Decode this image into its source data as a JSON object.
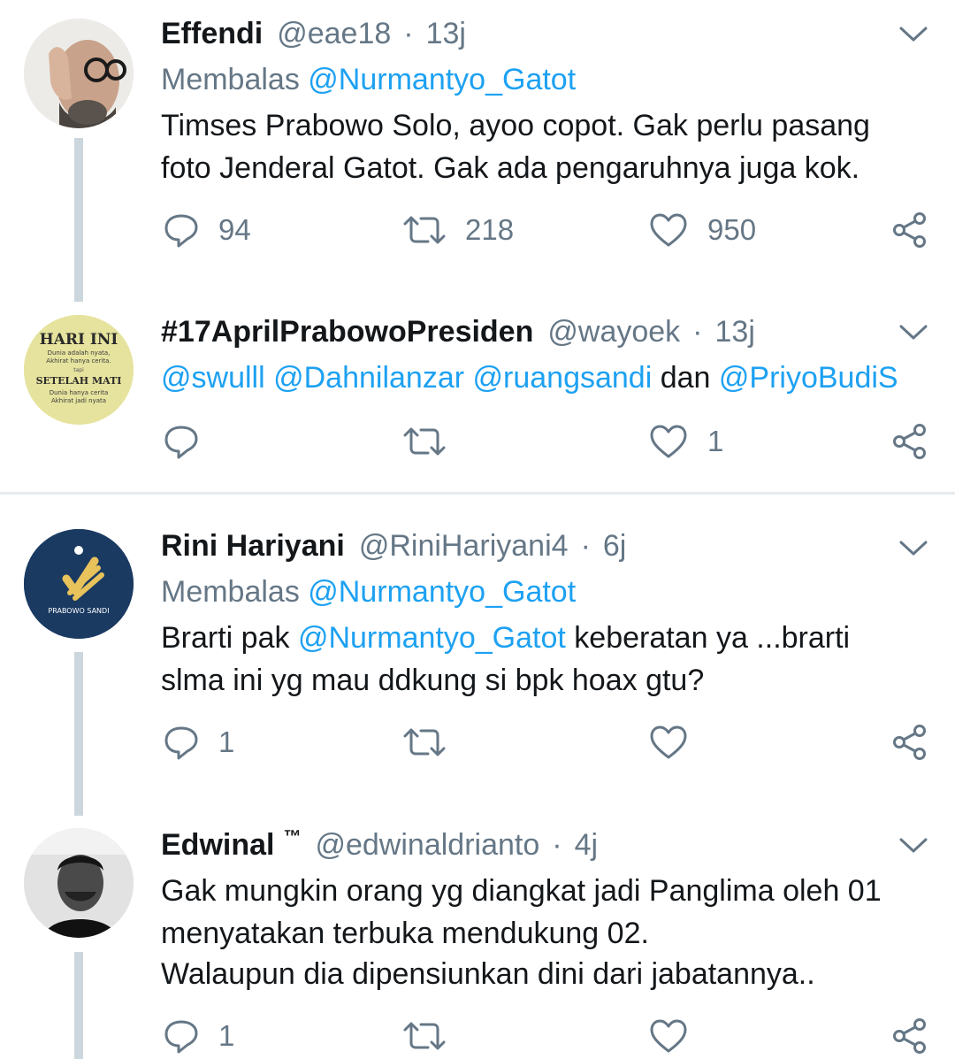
{
  "tweets": [
    {
      "name": "Effendi",
      "handle": "@eae18",
      "separator": "·",
      "time": "13j",
      "reply_prefix": "Membalas",
      "reply_to": "@Nurmantyo_Gatot",
      "text_line1": "Timses Prabowo Solo, ayoo copot. Gak perlu pasang",
      "text_line2": "foto Jenderal Gatot. Gak ada pengaruhnya juga kok.",
      "replies": "94",
      "retweets": "218",
      "likes": "950"
    },
    {
      "name": "#17AprilPrabowoPresiden",
      "handle": "@wayoek",
      "separator": "·",
      "time": "13j",
      "mentions": [
        "@swulll",
        "@Dahnilanzar",
        "@ruangsandi"
      ],
      "conj": "dan",
      "last_mention": "@PriyoBudiS",
      "likes": "1",
      "avatar_text": {
        "l1": "HARI INI",
        "l2": "Dunia adalah nyata,",
        "l3": "Akhirat hanya cerita.",
        "l4": "tapi",
        "l5": "SETELAH MATI",
        "l6": "Dunia hanya cerita",
        "l7": "Akhirat jadi nyata"
      }
    },
    {
      "name": "Rini Hariyani",
      "handle": "@RiniHariyani4",
      "separator": "·",
      "time": "6j",
      "reply_prefix": "Membalas",
      "reply_to": "@Nurmantyo_Gatot",
      "text_pre": "Brarti pak",
      "text_mention": "@Nurmantyo_Gatot",
      "text_post": "keberatan ya ...brarti",
      "text_line2": "slma ini yg mau ddkung si bpk hoax gtu?",
      "replies": "1",
      "avatar_text": "PRABOWO SANDI"
    },
    {
      "name": "Edwinal",
      "tm": "™",
      "handle": "@edwinaldrianto",
      "separator": "·",
      "time": "4j",
      "text_line1": "Gak mungkin orang yg diangkat jadi Panglima oleh 01",
      "text_line2": "menyatakan terbuka mendukung 02.",
      "text_line3": "Walaupun dia dipensiunkan dini dari jabatannya..",
      "replies": "1"
    }
  ],
  "colors": {
    "link": "#1da1f2",
    "secondary": "#657786",
    "thread_line": "#ccd6dd",
    "like_red": "#e0245e"
  }
}
